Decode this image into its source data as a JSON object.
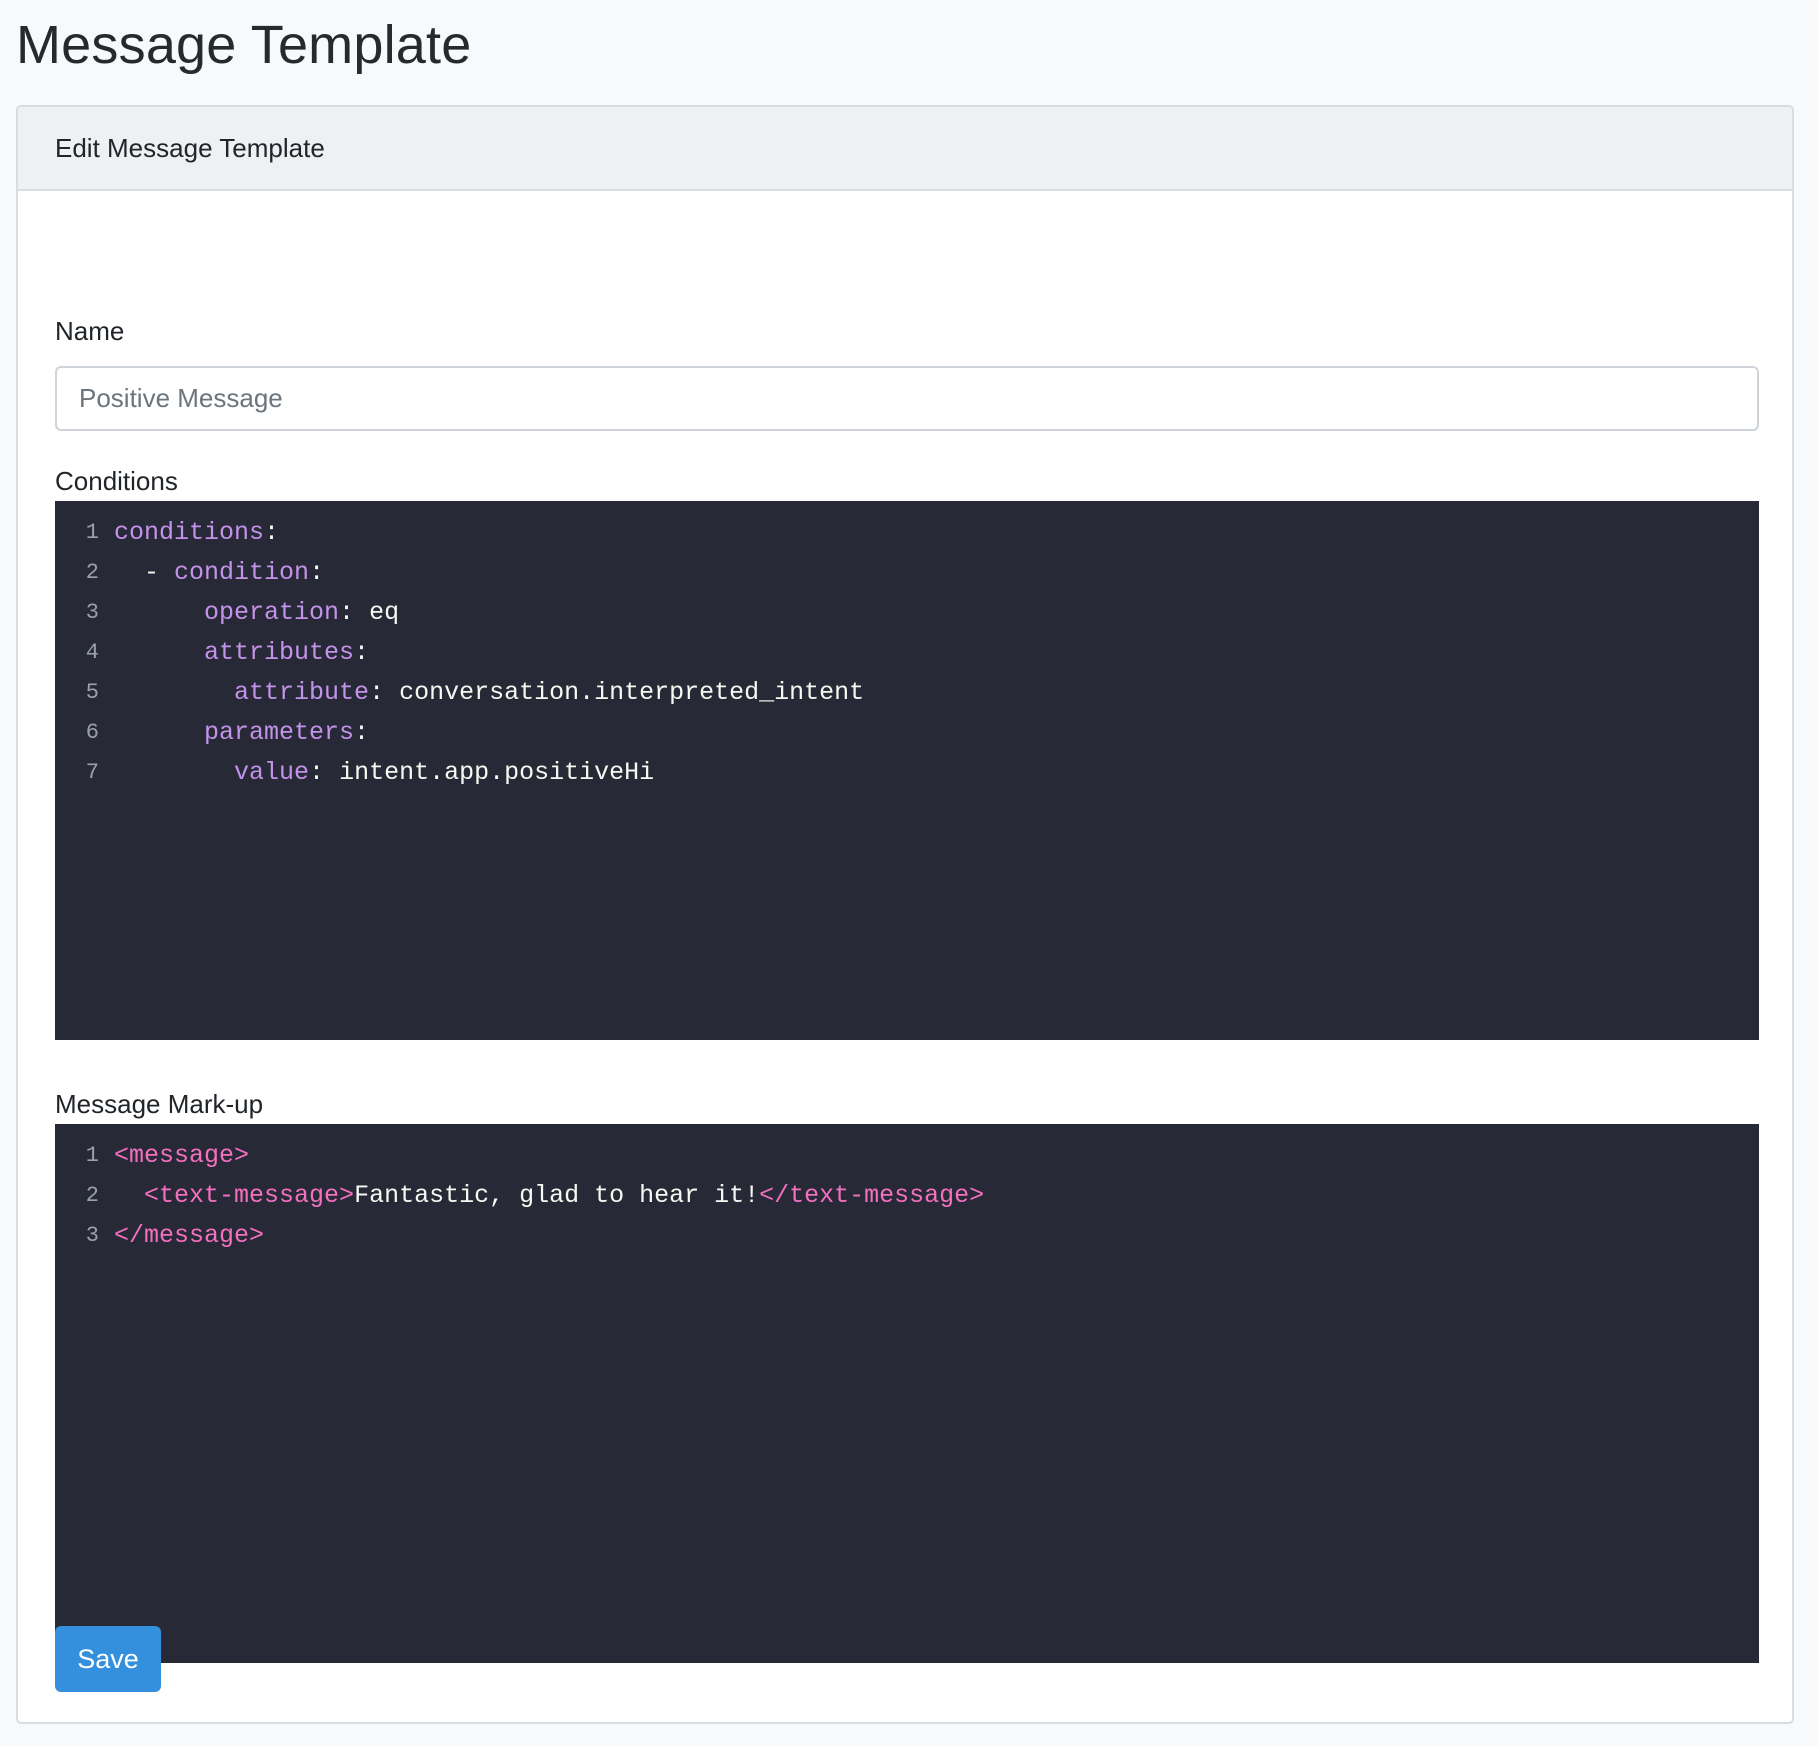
{
  "page": {
    "title": "Message Template"
  },
  "card": {
    "header": "Edit Message Template"
  },
  "form": {
    "name_label": "Name",
    "name_placeholder": "Positive Message",
    "name_value": "",
    "conditions_label": "Conditions",
    "markup_label": "Message Mark-up",
    "save_label": "Save"
  },
  "conditions_editor": {
    "lines": [
      {
        "n": "1",
        "indent": "",
        "prefix": "",
        "key": "conditions",
        "sep": ":",
        "value": ""
      },
      {
        "n": "2",
        "indent": "  ",
        "prefix": "- ",
        "key": "condition",
        "sep": ":",
        "value": ""
      },
      {
        "n": "3",
        "indent": "      ",
        "prefix": "",
        "key": "operation",
        "sep": ":",
        "value": " eq"
      },
      {
        "n": "4",
        "indent": "      ",
        "prefix": "",
        "key": "attributes",
        "sep": ":",
        "value": ""
      },
      {
        "n": "5",
        "indent": "        ",
        "prefix": "",
        "key": "attribute",
        "sep": ":",
        "value": " conversation.interpreted_intent"
      },
      {
        "n": "6",
        "indent": "      ",
        "prefix": "",
        "key": "parameters",
        "sep": ":",
        "value": ""
      },
      {
        "n": "7",
        "indent": "        ",
        "prefix": "",
        "key": "value",
        "sep": ":",
        "value": " intent.app.positiveHi"
      }
    ]
  },
  "markup_editor": {
    "lines": [
      {
        "n": "1",
        "indent": "",
        "open": "<message>",
        "text": "",
        "close": ""
      },
      {
        "n": "2",
        "indent": "  ",
        "open": "<text-message>",
        "text": "Fantastic, glad to hear it!",
        "close": "</text-message>"
      },
      {
        "n": "3",
        "indent": "",
        "open": "</message>",
        "text": "",
        "close": ""
      }
    ]
  },
  "colors": {
    "editor_bg": "#272a36",
    "yaml_key": "#c392ea",
    "xml_tag": "#f36fc0",
    "button": "#3490dc"
  }
}
